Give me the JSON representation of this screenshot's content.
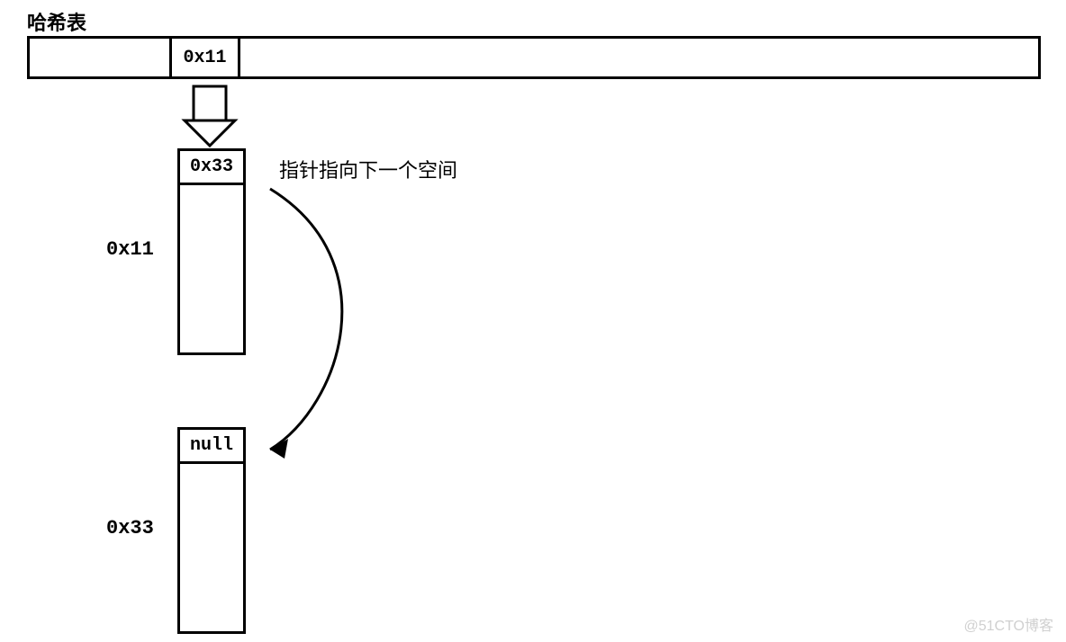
{
  "title": "哈希表",
  "table": {
    "slot_value": "0x11"
  },
  "node1": {
    "address_label": "0x11",
    "pointer_value": "0x33"
  },
  "node2": {
    "address_label": "0x33",
    "pointer_value": "null"
  },
  "annotation": "指针指向下一个空间",
  "watermark": "@51CTO博客"
}
